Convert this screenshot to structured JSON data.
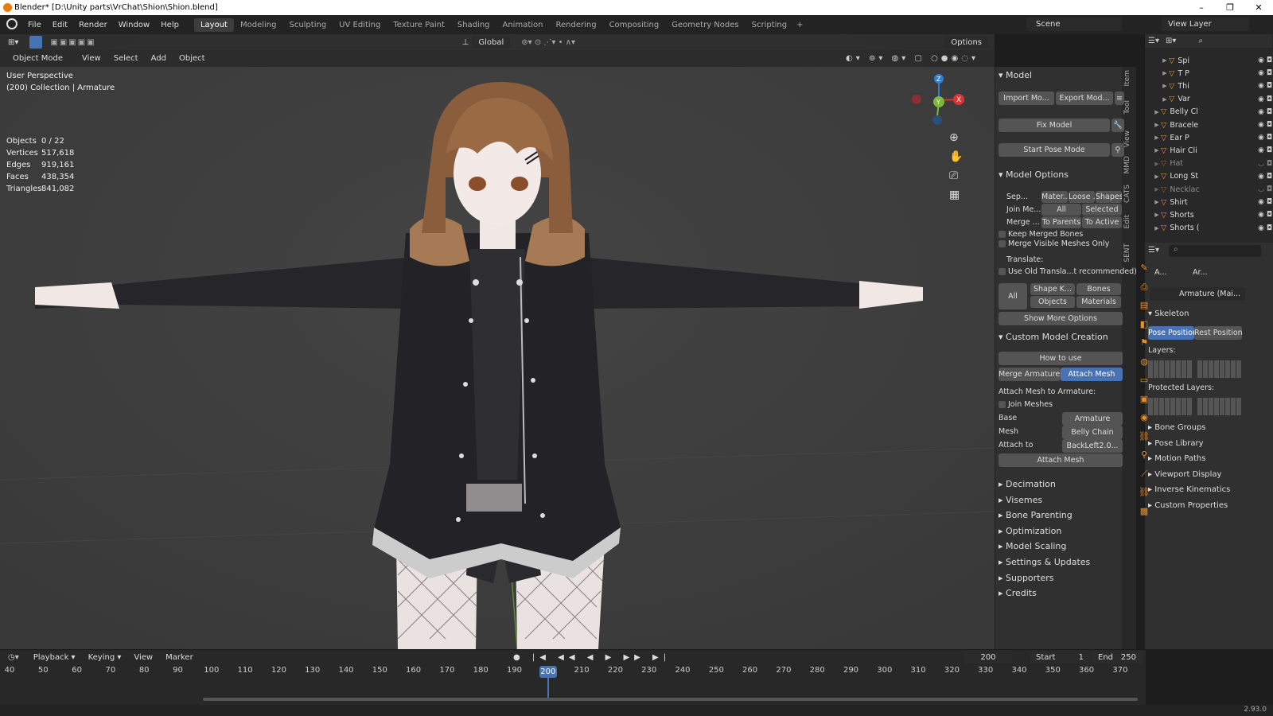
{
  "window": {
    "title": "Blender* [D:\\Unity parts\\VrChat\\Shion\\Shion.blend]"
  },
  "menu": [
    "File",
    "Edit",
    "Render",
    "Window",
    "Help"
  ],
  "workspaces": [
    "Layout",
    "Modeling",
    "Sculpting",
    "UV Editing",
    "Texture Paint",
    "Shading",
    "Animation",
    "Rendering",
    "Compositing",
    "Geometry Nodes",
    "Scripting"
  ],
  "active_workspace": "Layout",
  "scene": "Scene",
  "view_layer": "View Layer",
  "viewport": {
    "transform": "Global",
    "options_label": "Options",
    "mode": "Object Mode",
    "header_menus": [
      "View",
      "Select",
      "Add",
      "Object"
    ],
    "perspective": "User Perspective",
    "collection": "(200) Collection | Armature",
    "stats": [
      {
        "k": "Objects",
        "v": "0 / 22"
      },
      {
        "k": "Vertices",
        "v": "517,618"
      },
      {
        "k": "Edges",
        "v": "919,161"
      },
      {
        "k": "Faces",
        "v": "438,354"
      },
      {
        "k": "Triangles",
        "v": "841,082"
      }
    ],
    "axes": {
      "x": "X",
      "y": "Y",
      "z": "Z"
    }
  },
  "npanel": {
    "tabs": [
      "Item",
      "Tool",
      "View",
      "MMD",
      "CATS",
      "Edit",
      "SENT"
    ],
    "model_header": "Model",
    "import_btn": "Import Mo...",
    "export_btn": "Export Mod...",
    "fix_model": "Fix Model",
    "start_pose": "Start Pose Mode",
    "model_options_header": "Model Options",
    "sep_label": "Sep...",
    "sep_opts": [
      "Mater...",
      "Loose ...",
      "Shapes"
    ],
    "join_label": "Join Me...",
    "join_opts": [
      "All",
      "Selected"
    ],
    "merge_label": "Merge ...",
    "merge_opts": [
      "To Parents",
      "To Active"
    ],
    "keep_merged": "Keep Merged Bones",
    "merge_visible": "Merge Visible Meshes Only",
    "translate": "Translate:",
    "use_old": "Use Old Transla...t recommended)",
    "all_label": "All",
    "trans_opts": [
      "Shape K...",
      "Bones",
      "Objects",
      "Materials"
    ],
    "show_more": "Show More Options",
    "custom_header": "Custom Model Creation",
    "how_to_use": "How to use",
    "merge_armatures": "Merge Armatures",
    "attach_mesh_tab": "Attach Mesh",
    "attach_to_arm": "Attach Mesh to Armature:",
    "join_meshes": "Join Meshes",
    "base_label": "Base",
    "base_val": "Armature",
    "mesh_label": "Mesh",
    "mesh_val": "Belly Chain",
    "attach_label": "Attach to",
    "attach_val": "BackLeft2.0...",
    "attach_btn": "Attach Mesh",
    "collapsed": [
      "Decimation",
      "Visemes",
      "Bone Parenting",
      "Optimization",
      "Model Scaling",
      "Settings & Updates",
      "Supporters",
      "Credits"
    ]
  },
  "outliner": [
    {
      "name": "Spi",
      "indent": 2,
      "dim": false,
      "eye": true
    },
    {
      "name": "T P",
      "indent": 2,
      "dim": false,
      "eye": true
    },
    {
      "name": "Thi",
      "indent": 2,
      "dim": false,
      "eye": true
    },
    {
      "name": "Var",
      "indent": 2,
      "dim": false,
      "eye": true
    },
    {
      "name": "Belly Cl",
      "indent": 1,
      "dim": false,
      "eye": true
    },
    {
      "name": "Bracele",
      "indent": 1,
      "dim": false,
      "eye": true
    },
    {
      "name": "Ear P",
      "indent": 1,
      "dim": false,
      "eye": true
    },
    {
      "name": "Hair Cli",
      "indent": 1,
      "dim": false,
      "eye": true
    },
    {
      "name": "Hat",
      "indent": 1,
      "dim": true,
      "eye": false
    },
    {
      "name": "Long St",
      "indent": 1,
      "dim": false,
      "eye": true
    },
    {
      "name": "Necklac",
      "indent": 1,
      "dim": true,
      "eye": false
    },
    {
      "name": "Shirt",
      "indent": 1,
      "dim": false,
      "eye": true
    },
    {
      "name": "Shorts",
      "indent": 1,
      "dim": false,
      "eye": true
    },
    {
      "name": "Shorts (",
      "indent": 1,
      "dim": false,
      "eye": true
    }
  ],
  "props": {
    "obj_name": "A...",
    "arm_name": "Ar...",
    "data_name": "Armature (Mai...",
    "skeleton": "Skeleton",
    "pose_pos": "Pose Position",
    "rest_pos": "Rest Position",
    "layers": "Layers:",
    "protected": "Protected Layers:",
    "collapsed": [
      "Bone Groups",
      "Pose Library",
      "Motion Paths",
      "Viewport Display",
      "Inverse Kinematics",
      "Custom Properties"
    ]
  },
  "timeline": {
    "menus": [
      "Playback",
      "Keying",
      "View",
      "Marker"
    ],
    "current": "200",
    "start_label": "Start",
    "start": "1",
    "end_label": "End",
    "end": "250",
    "ticks": [
      "40",
      "50",
      "60",
      "70",
      "80",
      "90",
      "100",
      "110",
      "120",
      "130",
      "140",
      "150",
      "160",
      "170",
      "180",
      "190",
      "200",
      "210",
      "220",
      "230",
      "240",
      "250",
      "260",
      "270",
      "280",
      "290",
      "300",
      "310",
      "320",
      "330",
      "340",
      "350",
      "360",
      "370"
    ]
  },
  "version": "2.93.0",
  "colors": {
    "accent": "#4772b3",
    "object_orange": "#e88f2e",
    "viewport_bg": "#3d3d3d"
  }
}
